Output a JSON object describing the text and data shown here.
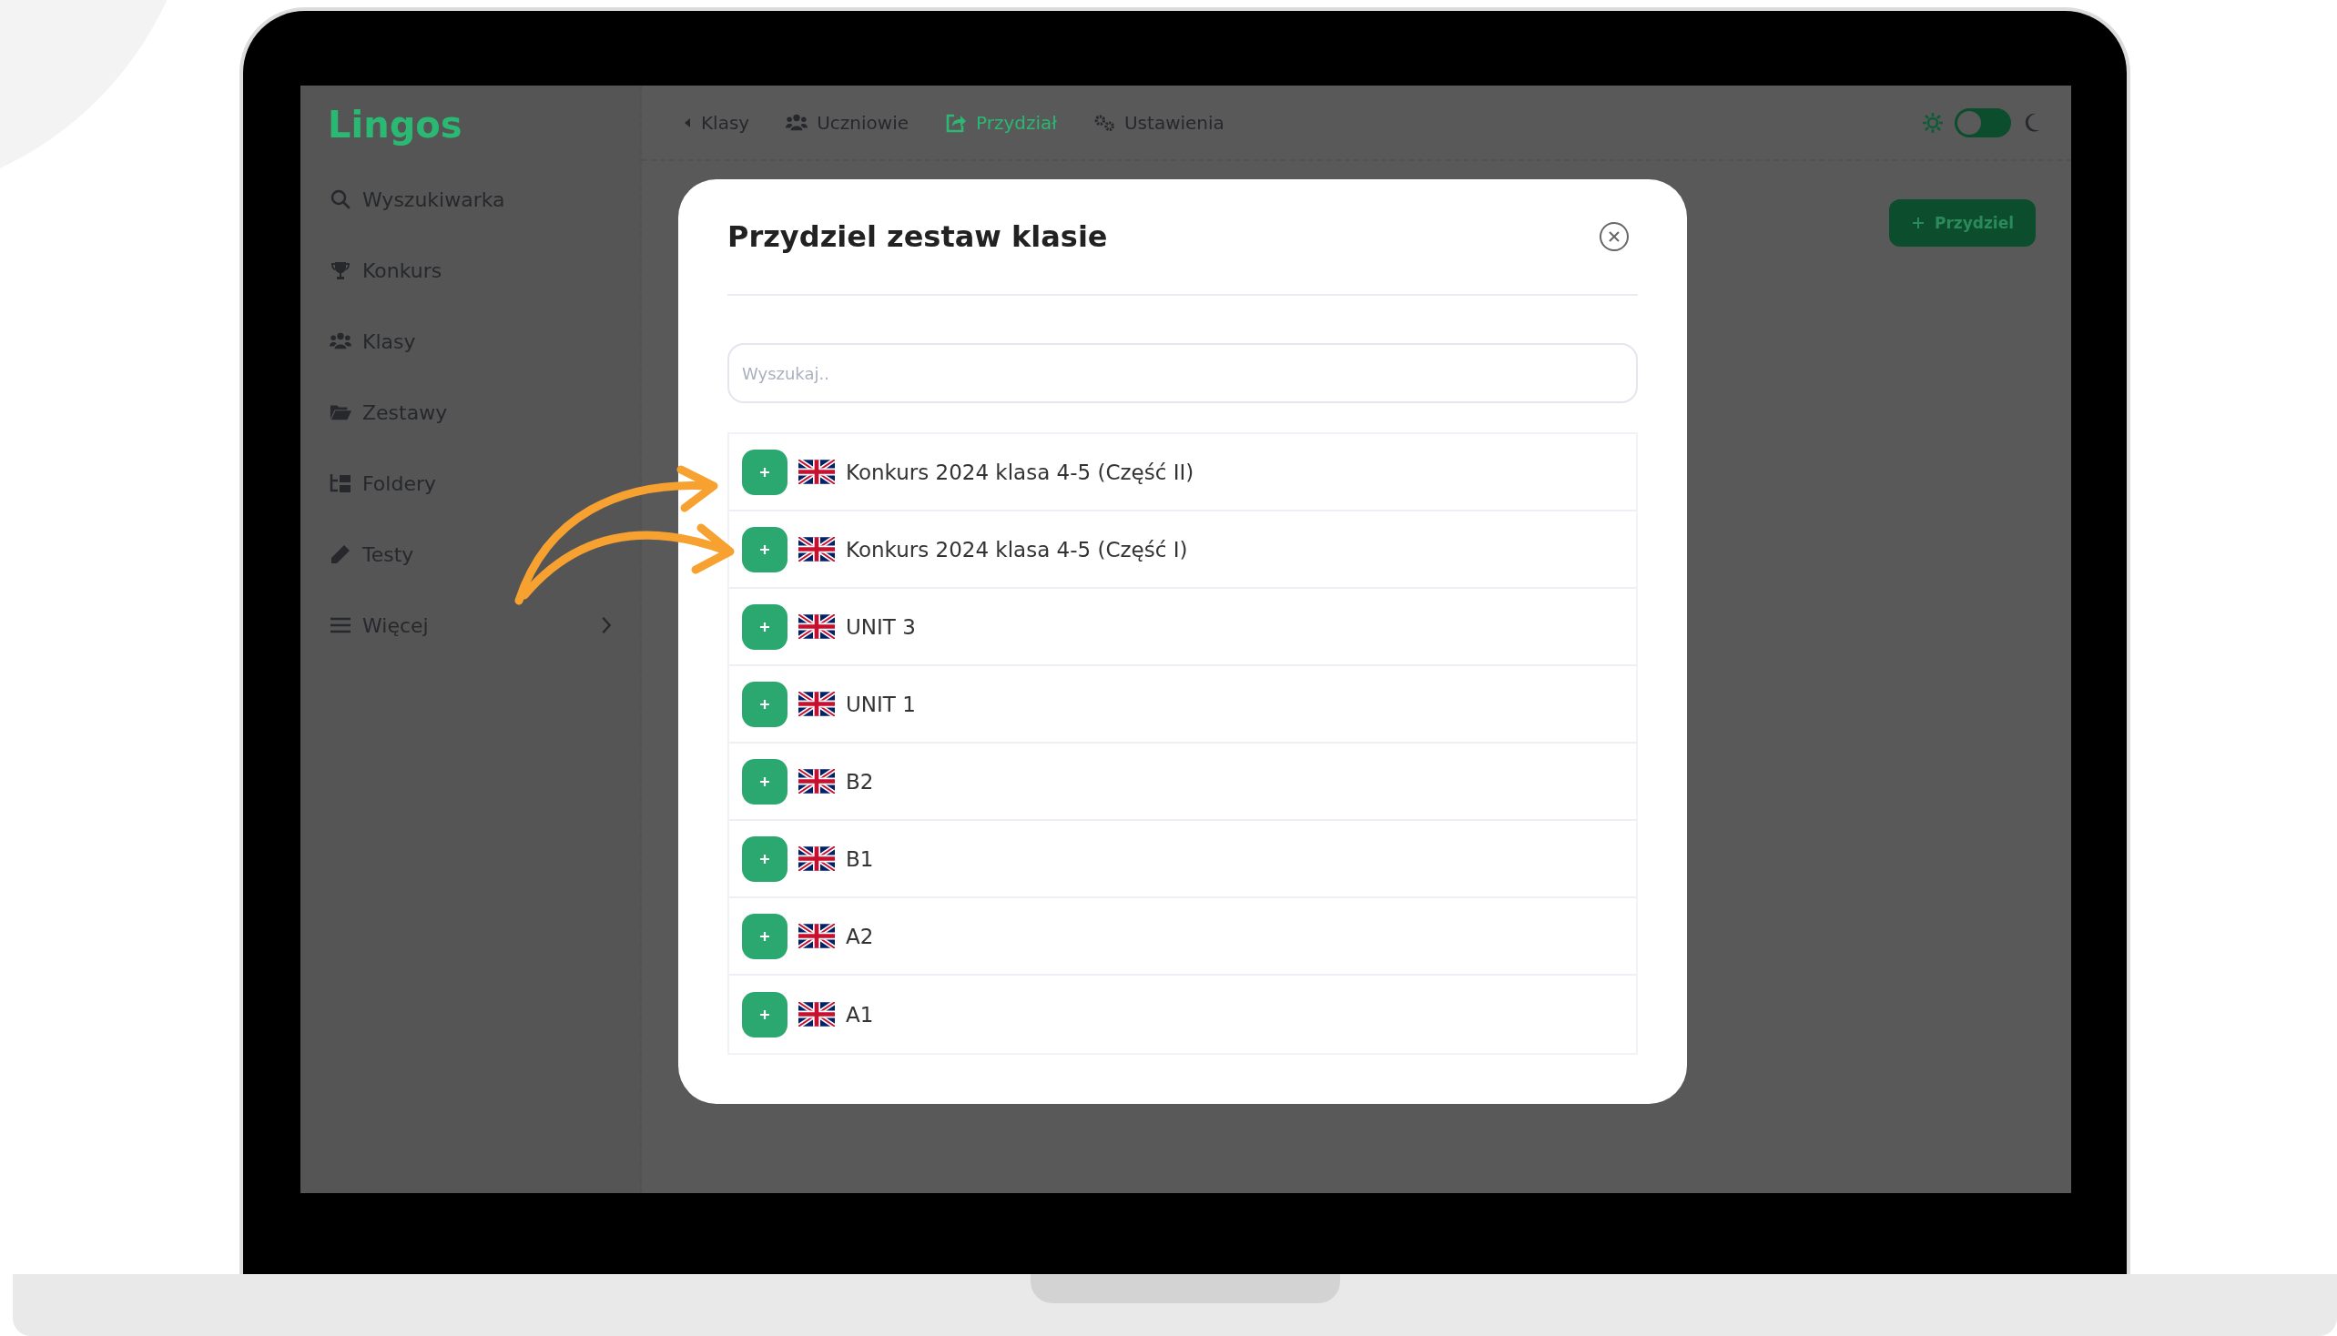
{
  "sidebar": {
    "logo": "Lingos",
    "items": [
      {
        "label": "Wyszukiwarka"
      },
      {
        "label": "Konkurs"
      },
      {
        "label": "Klasy"
      },
      {
        "label": "Zestawy"
      },
      {
        "label": "Foldery"
      },
      {
        "label": "Testy"
      },
      {
        "label": "Więcej",
        "kind": "expandable"
      }
    ]
  },
  "top_nav": {
    "items": [
      {
        "label": "Klasy",
        "selected": false
      },
      {
        "label": "Uczniowie",
        "selected": false
      },
      {
        "label": "Przydział",
        "selected": true
      },
      {
        "label": "Ustawienia",
        "selected": false
      }
    ],
    "dark_mode": {
      "on": false
    }
  },
  "assign_button": {
    "label": "Przydziel"
  },
  "dialog": {
    "title": "Przydziel zestaw klasie",
    "search": {
      "placeholder": "Wyszukaj.."
    },
    "sets": [
      {
        "name": "Konkurs 2024 klasa 4-5 (Część II)"
      },
      {
        "name": "Konkurs 2024 klasa 4-5 (Część I)"
      },
      {
        "name": "UNIT 3"
      },
      {
        "name": "UNIT 1"
      },
      {
        "name": "B2"
      },
      {
        "name": "B1"
      },
      {
        "name": "A2"
      },
      {
        "name": "A1"
      }
    ]
  }
}
